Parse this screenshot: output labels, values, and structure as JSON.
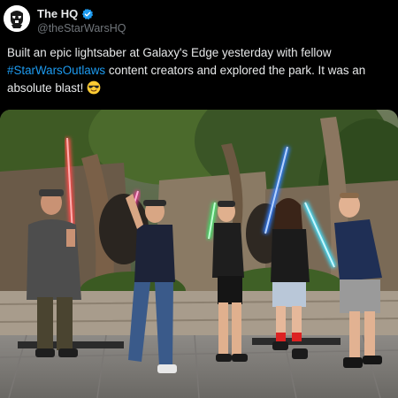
{
  "post": {
    "display_name": "The HQ",
    "handle": "@theStarWarsHQ",
    "verified_icon": "verified-badge-icon",
    "avatar_icon": "stormtrooper-helmet-icon",
    "text_before": "Built an epic lightsaber at Galaxy's Edge yesterday with fellow ",
    "hashtag": "#StarWarsOutlaws",
    "text_after": " content creators and explored the park. It was an absolute blast! ",
    "emoji_icon": "sunglasses-emoji-icon",
    "colors": {
      "link": "#1d9bf0",
      "verified": "#1d9bf0",
      "text": "#e7e9ea",
      "muted": "#71767b"
    }
  },
  "media": {
    "photo_subject": "group-photo-with-lightsabers",
    "saber_colors": [
      "#ff4a4a",
      "#e23c8c",
      "#3fe06a",
      "#2f7bff",
      "#3fe0ff"
    ]
  }
}
